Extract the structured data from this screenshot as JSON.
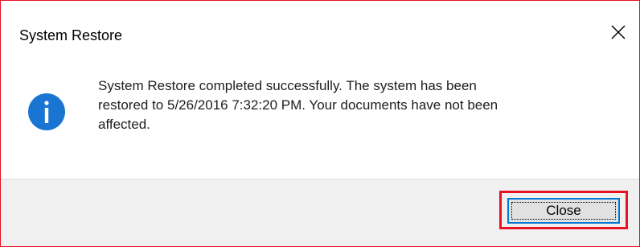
{
  "dialog": {
    "title": "System Restore",
    "message": "System Restore completed successfully. The system has been\nrestored to 5/26/2016 7:32:20 PM. Your documents have not been\naffected.",
    "icon": "info-icon",
    "close_button_label": "Close",
    "title_close_icon": "close-icon"
  },
  "colors": {
    "highlight": "#e81123",
    "info_icon": "#1a75d2",
    "footer_bg": "#f0f0f0",
    "button_border": "#0078d7"
  }
}
